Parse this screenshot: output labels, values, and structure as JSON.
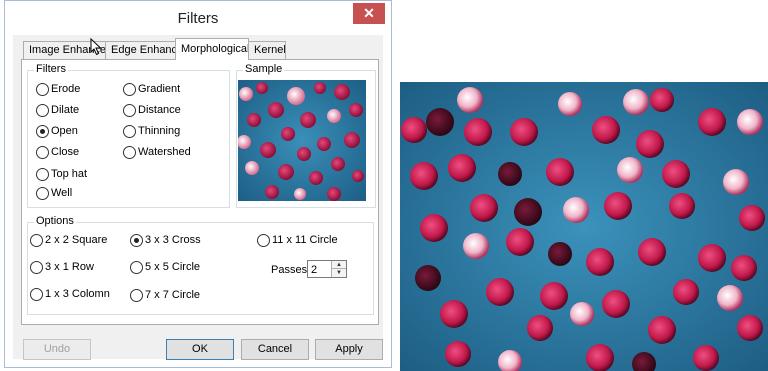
{
  "dialog": {
    "title": "Filters",
    "close_glyph": "✕"
  },
  "tabs": [
    {
      "label": "Image Enhance",
      "active": false
    },
    {
      "label": "Edge Enhance",
      "active": false
    },
    {
      "label": "Morphological",
      "active": true
    },
    {
      "label": "Kernel",
      "active": false
    }
  ],
  "filters": {
    "label": "Filters",
    "options": [
      {
        "label": "Erode",
        "selected": false
      },
      {
        "label": "Dilate",
        "selected": false
      },
      {
        "label": "Open",
        "selected": true
      },
      {
        "label": "Close",
        "selected": false
      },
      {
        "label": "Top hat",
        "selected": false
      },
      {
        "label": "Well",
        "selected": false
      },
      {
        "label": "Gradient",
        "selected": false
      },
      {
        "label": "Distance",
        "selected": false
      },
      {
        "label": "Thinning",
        "selected": false
      },
      {
        "label": "Watershed",
        "selected": false
      }
    ]
  },
  "sample": {
    "label": "Sample"
  },
  "options": {
    "label": "Options",
    "kernels": [
      {
        "label": "2 x 2 Square",
        "selected": false
      },
      {
        "label": "3 x 1 Row",
        "selected": false
      },
      {
        "label": "1 x 3 Colomn",
        "selected": false
      },
      {
        "label": "3 x 3 Cross",
        "selected": true
      },
      {
        "label": "5 x 5 Circle",
        "selected": false
      },
      {
        "label": "7 x 7 Circle",
        "selected": false
      },
      {
        "label": "11 x 11 Circle",
        "selected": false
      }
    ],
    "passes_label": "Passes",
    "passes_value": "2"
  },
  "buttons": {
    "undo": "Undo",
    "ok": "OK",
    "cancel": "Cancel",
    "apply": "Apply"
  },
  "colors": {
    "close_button": "#c75050",
    "default_button_border": "#3c7fb1",
    "image_background": "#2f7fa8",
    "cell_fill": "#c2184a"
  },
  "icons": {
    "cursor": "mouse-pointer-icon",
    "spin_up": "chevron-up-icon",
    "spin_down": "chevron-down-icon"
  }
}
